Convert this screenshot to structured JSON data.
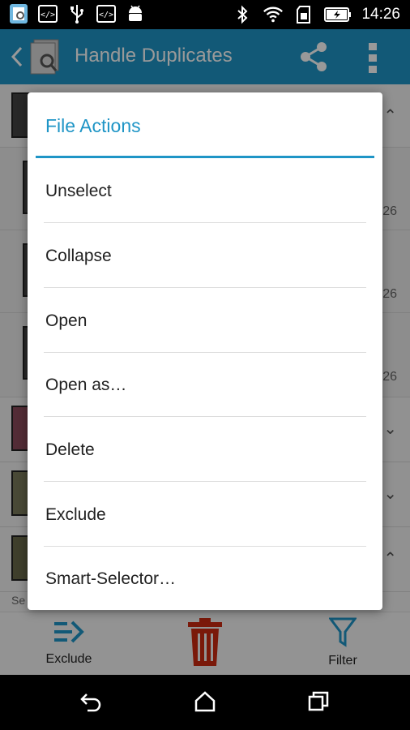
{
  "status_bar": {
    "time": "14:26",
    "left_icons": [
      "app-notification-icon",
      "code-icon",
      "usb-icon",
      "code-icon",
      "android-icon"
    ],
    "right_icons": [
      "bluetooth-icon",
      "wifi-icon",
      "sd-card-icon",
      "battery-charging-icon"
    ]
  },
  "action_bar": {
    "title": "Handle Duplicates",
    "color": "#1f95c6"
  },
  "background": {
    "numbers": [
      "26",
      "26",
      "26"
    ],
    "footer_text": "Se"
  },
  "bottom_bar": {
    "exclude_label": "Exclude",
    "filter_label": "Filter",
    "delete_color": "#cc2a12",
    "accent_color": "#1f95c6"
  },
  "dialog": {
    "title": "File Actions",
    "items": [
      "Unselect",
      "Collapse",
      "Open",
      "Open as…",
      "Delete",
      "Exclude",
      "Smart-Selector…"
    ]
  }
}
